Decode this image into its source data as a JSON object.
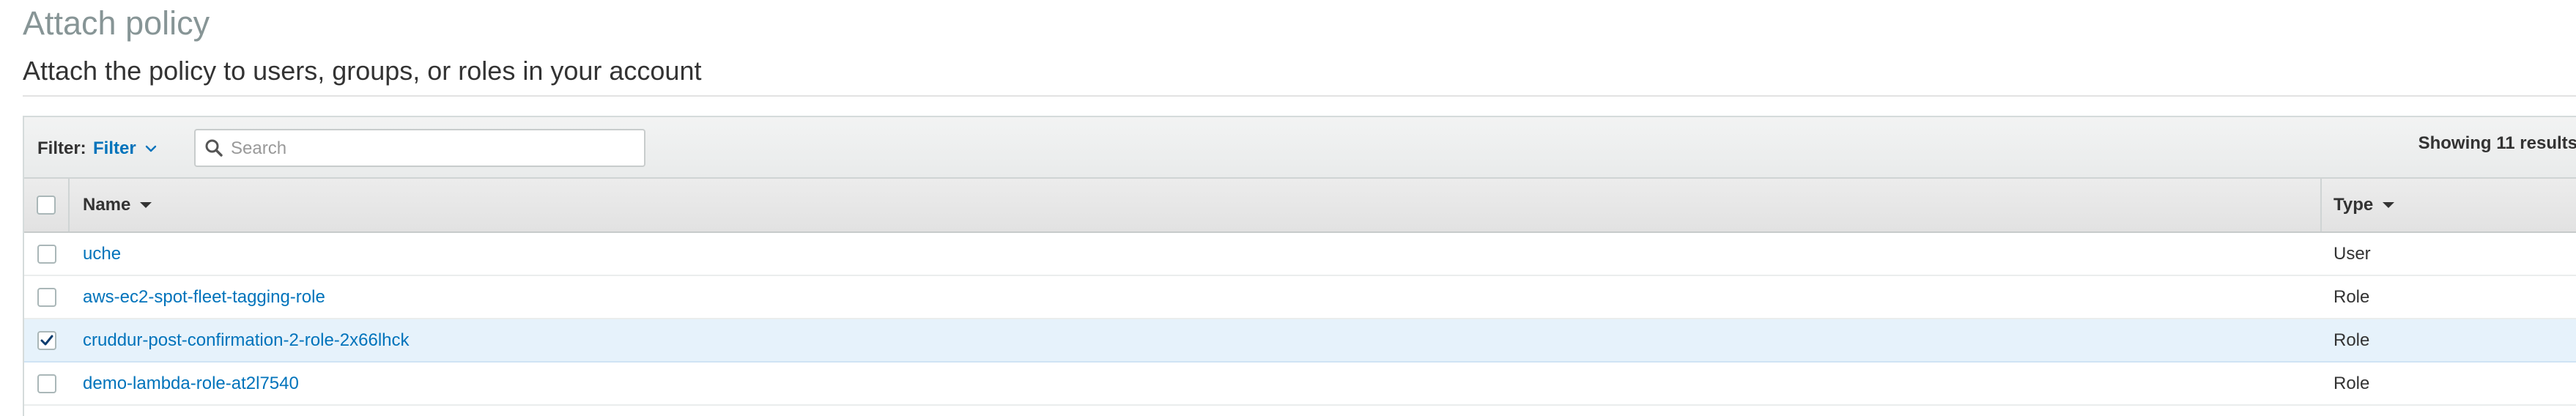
{
  "page": {
    "title": "Attach policy",
    "subtitle": "Attach the policy to users, groups, or roles in your account"
  },
  "filter_bar": {
    "filter_label": "Filter:",
    "filter_value": "Filter",
    "search_placeholder": "Search",
    "search_value": "",
    "results_text": "Showing 11 results"
  },
  "table": {
    "columns": [
      {
        "label": "Name",
        "sort_icon": "sort-down-icon"
      },
      {
        "label": "Type",
        "sort_icon": "sort-down-icon"
      }
    ],
    "header_checkbox_checked": false,
    "rows": [
      {
        "name": "uche",
        "type": "User",
        "checked": false
      },
      {
        "name": "aws-ec2-spot-fleet-tagging-role",
        "type": "Role",
        "checked": false
      },
      {
        "name": "cruddur-post-confirmation-2-role-2x66lhck",
        "type": "Role",
        "checked": true
      },
      {
        "name": "demo-lambda-role-at2l7540",
        "type": "Role",
        "checked": false
      }
    ]
  },
  "colors": {
    "link": "#0073bb",
    "title_gray": "#879596",
    "selected_row": "#e6f2fb",
    "checkmark": "#0b3c6e"
  }
}
